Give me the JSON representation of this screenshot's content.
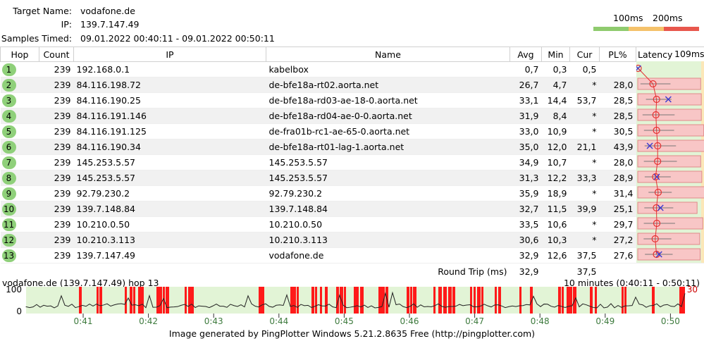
{
  "header": {
    "target_label": "Target Name:",
    "target_value": "vodafone.de",
    "ip_label": "IP:",
    "ip_value": "139.7.147.49",
    "samples_label": "Samples Timed:",
    "samples_value": "09.01.2022 00:40:11 - 09.01.2022 00:50:11"
  },
  "legend": {
    "label_100": "100ms",
    "label_200": "200ms",
    "colors": [
      "#8fcb6e",
      "#f5c26b",
      "#e8574d"
    ]
  },
  "columns": {
    "hop": "Hop",
    "count": "Count",
    "ip": "IP",
    "name": "Name",
    "avg": "Avg",
    "min": "Min",
    "cur": "Cur",
    "pl": "PL%",
    "latency": "Latency",
    "latency_max": "109ms"
  },
  "hops": [
    {
      "hop": "1",
      "count": "239",
      "ip": "192.168.0.1",
      "name": "kabelbox",
      "avg": "0,7",
      "min": "0,3",
      "cur": "0,5",
      "pl": ""
    },
    {
      "hop": "2",
      "count": "239",
      "ip": "84.116.198.72",
      "name": "de-bfe18a-rt02.aorta.net",
      "avg": "26,7",
      "min": "4,7",
      "cur": "*",
      "pl": "28,0"
    },
    {
      "hop": "3",
      "count": "239",
      "ip": "84.116.190.25",
      "name": "de-bfe18a-rd03-ae-18-0.aorta.net",
      "avg": "33,1",
      "min": "14,4",
      "cur": "53,7",
      "pl": "28,5"
    },
    {
      "hop": "4",
      "count": "239",
      "ip": "84.116.191.146",
      "name": "de-bfe18a-rd04-ae-0-0.aorta.net",
      "avg": "31,9",
      "min": "8,4",
      "cur": "*",
      "pl": "28,5"
    },
    {
      "hop": "5",
      "count": "239",
      "ip": "84.116.191.125",
      "name": "de-fra01b-rc1-ae-65-0.aorta.net",
      "avg": "33,0",
      "min": "10,9",
      "cur": "*",
      "pl": "30,5"
    },
    {
      "hop": "6",
      "count": "239",
      "ip": "84.116.190.34",
      "name": "de-bfe18a-rt01-lag-1.aorta.net",
      "avg": "35,0",
      "min": "12,0",
      "cur": "21,1",
      "pl": "43,9"
    },
    {
      "hop": "7",
      "count": "239",
      "ip": "145.253.5.57",
      "name": "145.253.5.57",
      "avg": "34,9",
      "min": "10,7",
      "cur": "*",
      "pl": "28,0"
    },
    {
      "hop": "8",
      "count": "239",
      "ip": "145.253.5.57",
      "name": "145.253.5.57",
      "avg": "31,3",
      "min": "12,2",
      "cur": "33,3",
      "pl": "28,9"
    },
    {
      "hop": "9",
      "count": "239",
      "ip": "92.79.230.2",
      "name": "92.79.230.2",
      "avg": "35,9",
      "min": "18,9",
      "cur": "*",
      "pl": "31,4"
    },
    {
      "hop": "10",
      "count": "239",
      "ip": "139.7.148.84",
      "name": "139.7.148.84",
      "avg": "32,7",
      "min": "11,5",
      "cur": "39,9",
      "pl": "25,1"
    },
    {
      "hop": "11",
      "count": "239",
      "ip": "10.210.0.50",
      "name": "10.210.0.50",
      "avg": "33,5",
      "min": "10,6",
      "cur": "*",
      "pl": "29,7"
    },
    {
      "hop": "12",
      "count": "239",
      "ip": "10.210.3.113",
      "name": "10.210.3.113",
      "avg": "30,6",
      "min": "10,3",
      "cur": "*",
      "pl": "27,2"
    },
    {
      "hop": "13",
      "count": "239",
      "ip": "139.7.147.49",
      "name": "vodafone.de",
      "avg": "32,9",
      "min": "12,6",
      "cur": "37,5",
      "pl": "27,6"
    }
  ],
  "round_trip": {
    "label": "Round Trip (ms)",
    "avg": "32,9",
    "cur": "37,5"
  },
  "timeline": {
    "title": "vodafone.de (139.7.147.49) hop 13",
    "range": "10 minutes (0:40:11 - 0:50:11)",
    "y_top": "100",
    "y_bottom": "0",
    "loss_max": "30",
    "x_labels": [
      "0:41",
      "0:42",
      "0:43",
      "0:44",
      "0:45",
      "0:46",
      "0:47",
      "0:48",
      "0:49",
      "0:50"
    ]
  },
  "footer": "Image generated by PingPlotter Windows 5.21.2.8635 Free (http://pingplotter.com)"
}
